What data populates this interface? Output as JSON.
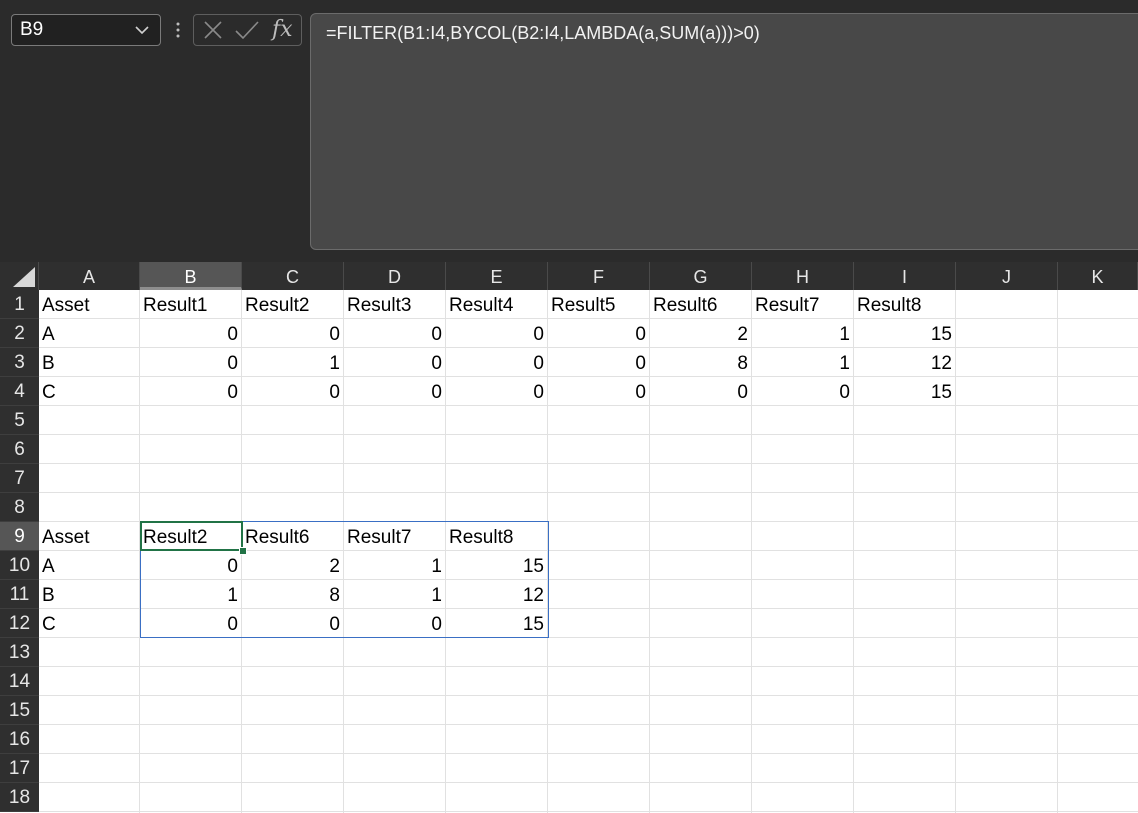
{
  "name_box": {
    "value": "B9",
    "icon": "chevron-down-icon"
  },
  "formula_bar": {
    "cancel_icon": "x-icon",
    "enter_icon": "checkmark-icon",
    "fx_label": "fx",
    "formula": "=FILTER(B1:I4,BYCOL(B2:I4,LAMBDA(a,SUM(a)))>0)"
  },
  "columns": [
    "A",
    "B",
    "C",
    "D",
    "E",
    "F",
    "G",
    "H",
    "I",
    "J",
    "K"
  ],
  "rows": [
    "1",
    "2",
    "3",
    "4",
    "5",
    "6",
    "7",
    "8",
    "9",
    "10",
    "11",
    "12",
    "13",
    "14",
    "15",
    "16",
    "17",
    "18"
  ],
  "selected_cell": {
    "column": "B",
    "row": "9"
  },
  "colors": {
    "active_border": "#217346",
    "spill_border": "#3a6fc4",
    "header_bg": "#2f2f2f"
  },
  "cells": {
    "1": {
      "A": "Asset",
      "B": "Result1",
      "C": "Result2",
      "D": "Result3",
      "E": "Result4",
      "F": "Result5",
      "G": "Result6",
      "H": "Result7",
      "I": "Result8"
    },
    "2": {
      "A": "A",
      "B": "0",
      "C": "0",
      "D": "0",
      "E": "0",
      "F": "0",
      "G": "2",
      "H": "1",
      "I": "15"
    },
    "3": {
      "A": "B",
      "B": "0",
      "C": "1",
      "D": "0",
      "E": "0",
      "F": "0",
      "G": "8",
      "H": "1",
      "I": "12"
    },
    "4": {
      "A": "C",
      "B": "0",
      "C": "0",
      "D": "0",
      "E": "0",
      "F": "0",
      "G": "0",
      "H": "0",
      "I": "15"
    },
    "9": {
      "A": "Asset",
      "B": "Result2",
      "C": "Result6",
      "D": "Result7",
      "E": "Result8"
    },
    "10": {
      "A": "A",
      "B": "0",
      "C": "2",
      "D": "1",
      "E": "15"
    },
    "11": {
      "A": "B",
      "B": "1",
      "C": "8",
      "D": "1",
      "E": "12"
    },
    "12": {
      "A": "C",
      "B": "0",
      "C": "0",
      "D": "0",
      "E": "15"
    }
  }
}
